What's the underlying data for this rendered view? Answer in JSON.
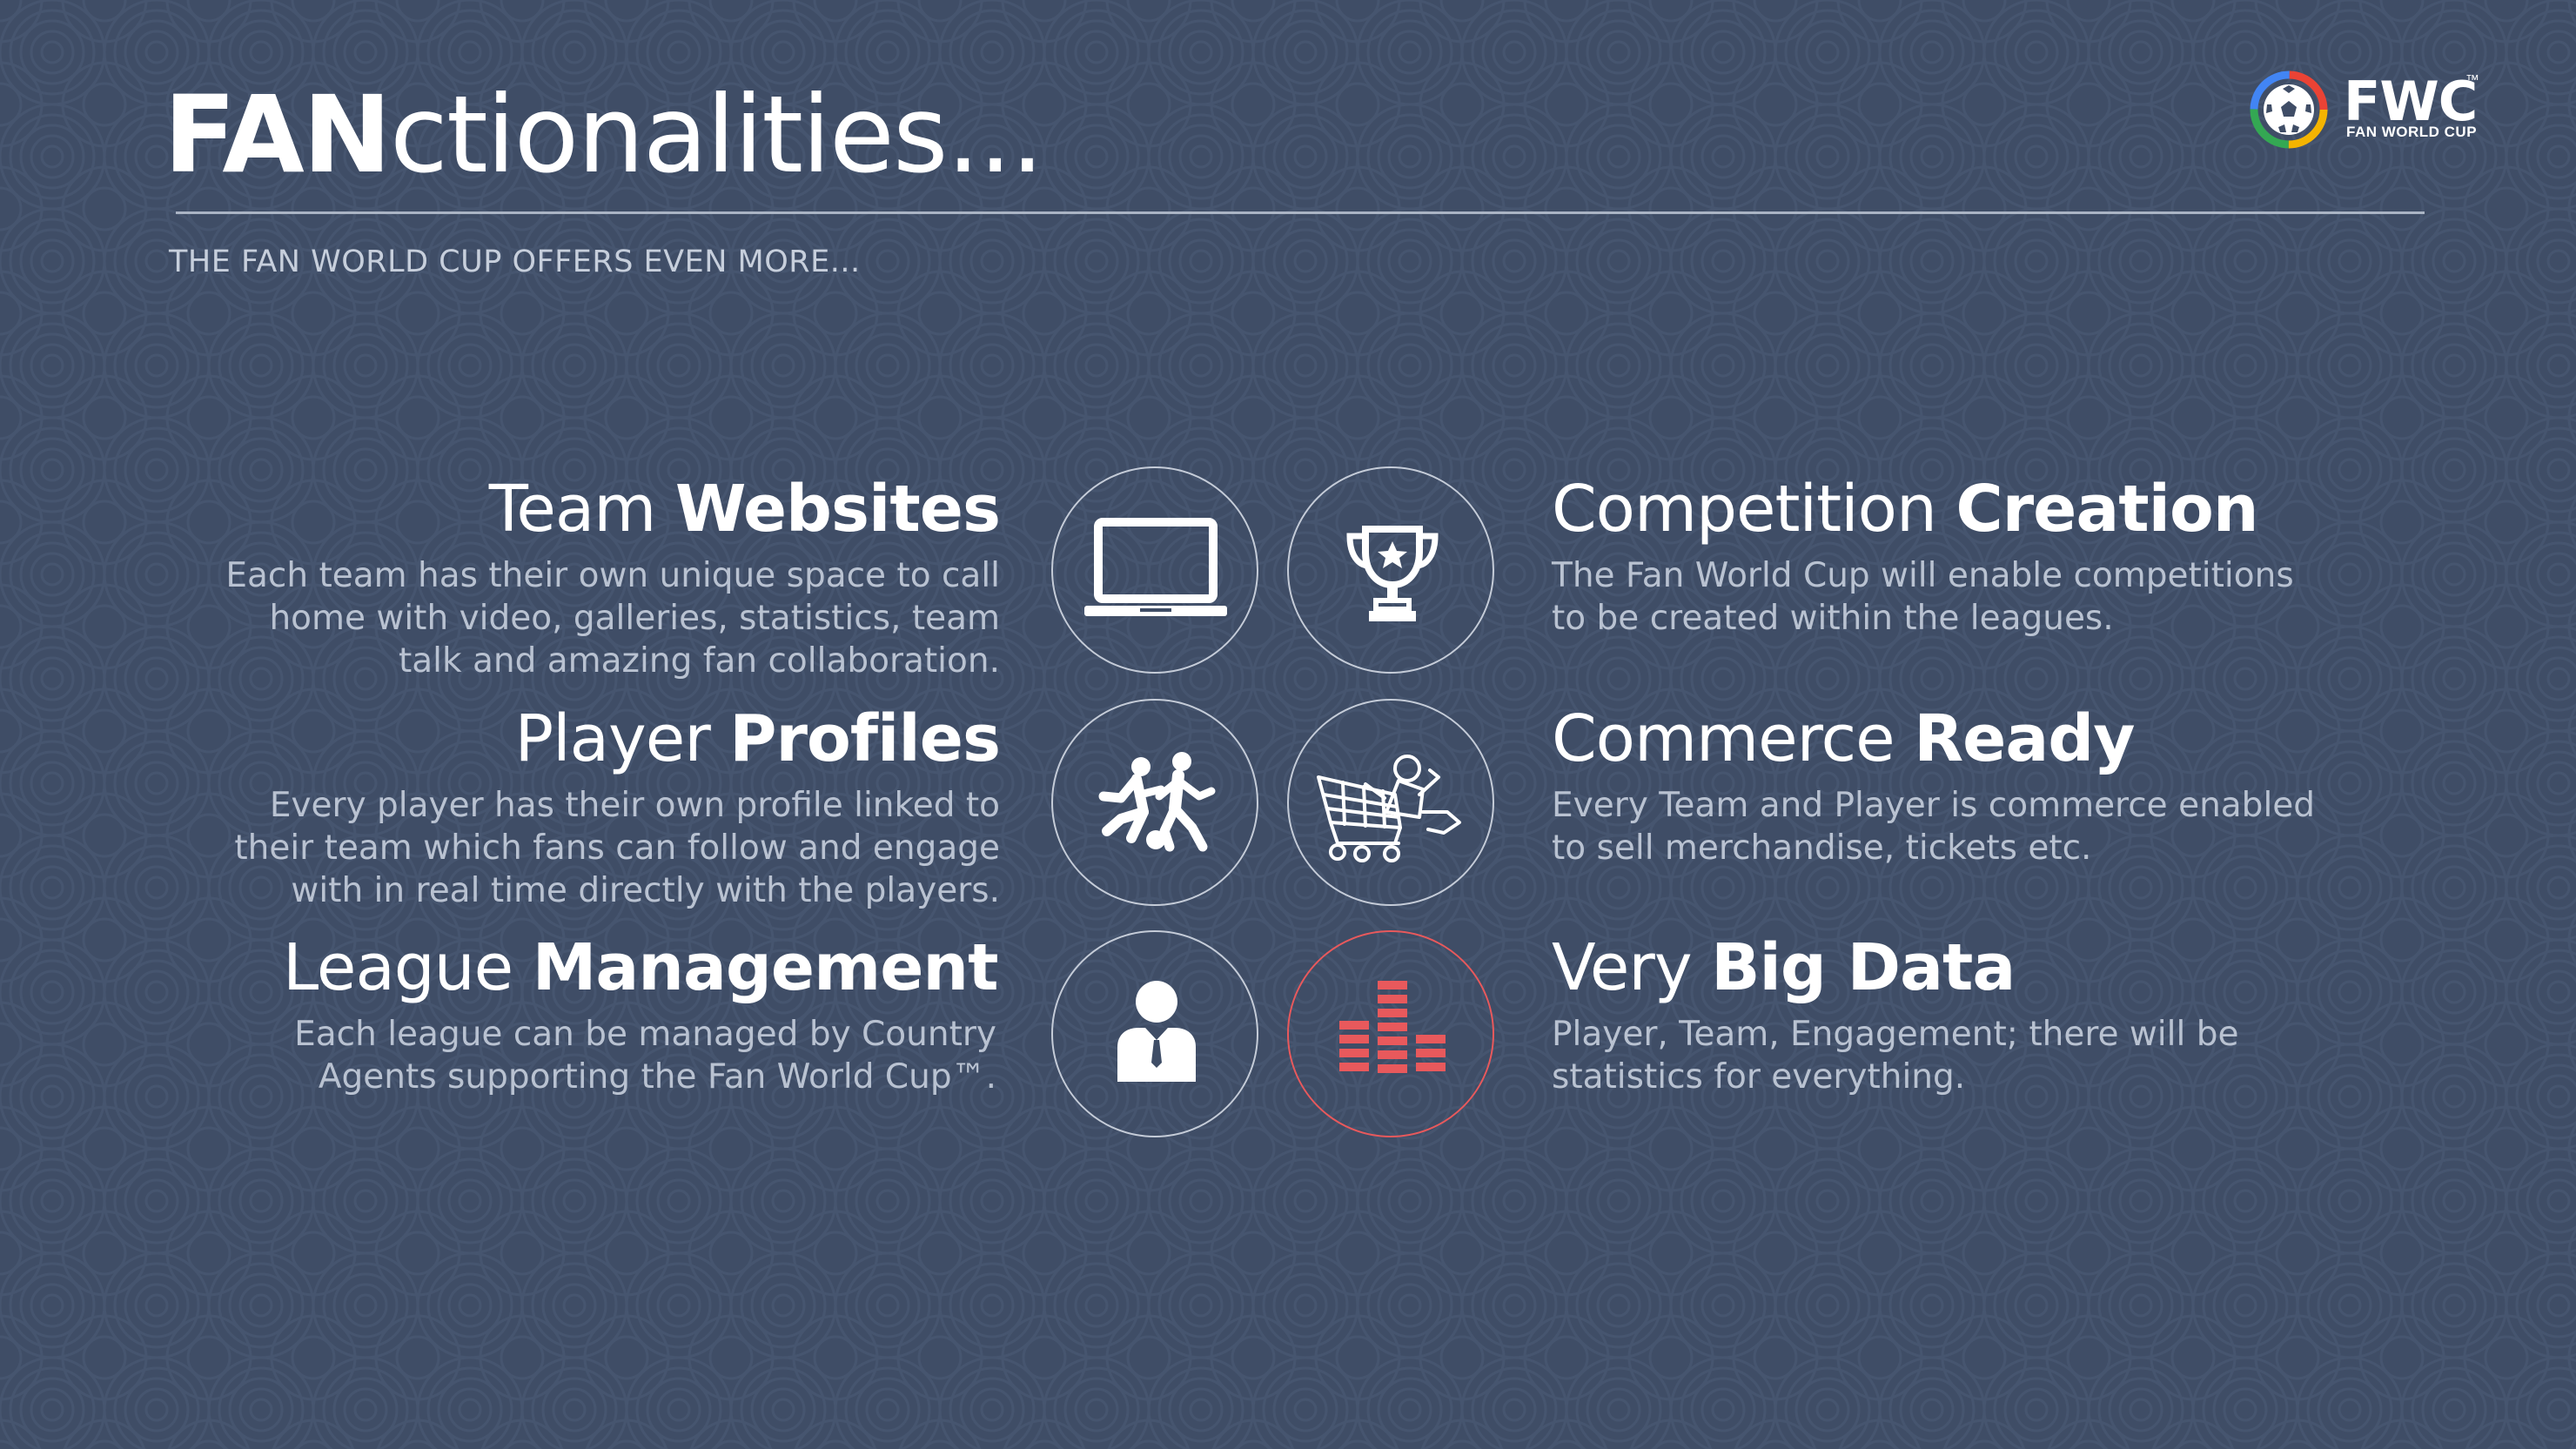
{
  "header": {
    "title_bold": "FAN",
    "title_light": "ctionalities...",
    "subtitle": "THE FAN WORLD CUP OFFERS EVEN MORE..."
  },
  "logo": {
    "text": "FWC",
    "tm": "™",
    "subtext": "FAN WORLD CUP"
  },
  "features": {
    "team_websites": {
      "title_light": "Team ",
      "title_bold": "Websites",
      "description": "Each team has their own unique space to call home with video, galleries, statistics, team talk and amazing fan collaboration.",
      "icon": "laptop-icon"
    },
    "player_profiles": {
      "title_light": "Player ",
      "title_bold": "Profiles",
      "description": "Every player has their own profile linked to their team which fans can follow and engage with in real time directly with the players.",
      "icon": "players-icon"
    },
    "league_management": {
      "title_light": "League ",
      "title_bold": "Management",
      "description": "Each league can be managed by Country Agents supporting the Fan World Cup™.",
      "icon": "manager-icon"
    },
    "competition_creation": {
      "title_light": "Competition ",
      "title_bold": "Creation",
      "description": "The Fan World Cup will enable competitions to be created within the leagues.",
      "icon": "trophy-icon"
    },
    "commerce_ready": {
      "title_light": "Commerce ",
      "title_bold": "Ready",
      "description": "Every Team and Player is commerce enabled to sell merchandise, tickets etc.",
      "icon": "shopping-cart-icon"
    },
    "big_data": {
      "title_light": "Very ",
      "title_bold": "Big Data",
      "description": "Player, Team, Engagement; there will be statistics for everything.",
      "icon": "equalizer-icon"
    }
  },
  "colors": {
    "background": "#3f4d66",
    "accent_red": "#e8595c",
    "text_light": "#b9c2d1",
    "circle_border": "#c5ccd8"
  }
}
